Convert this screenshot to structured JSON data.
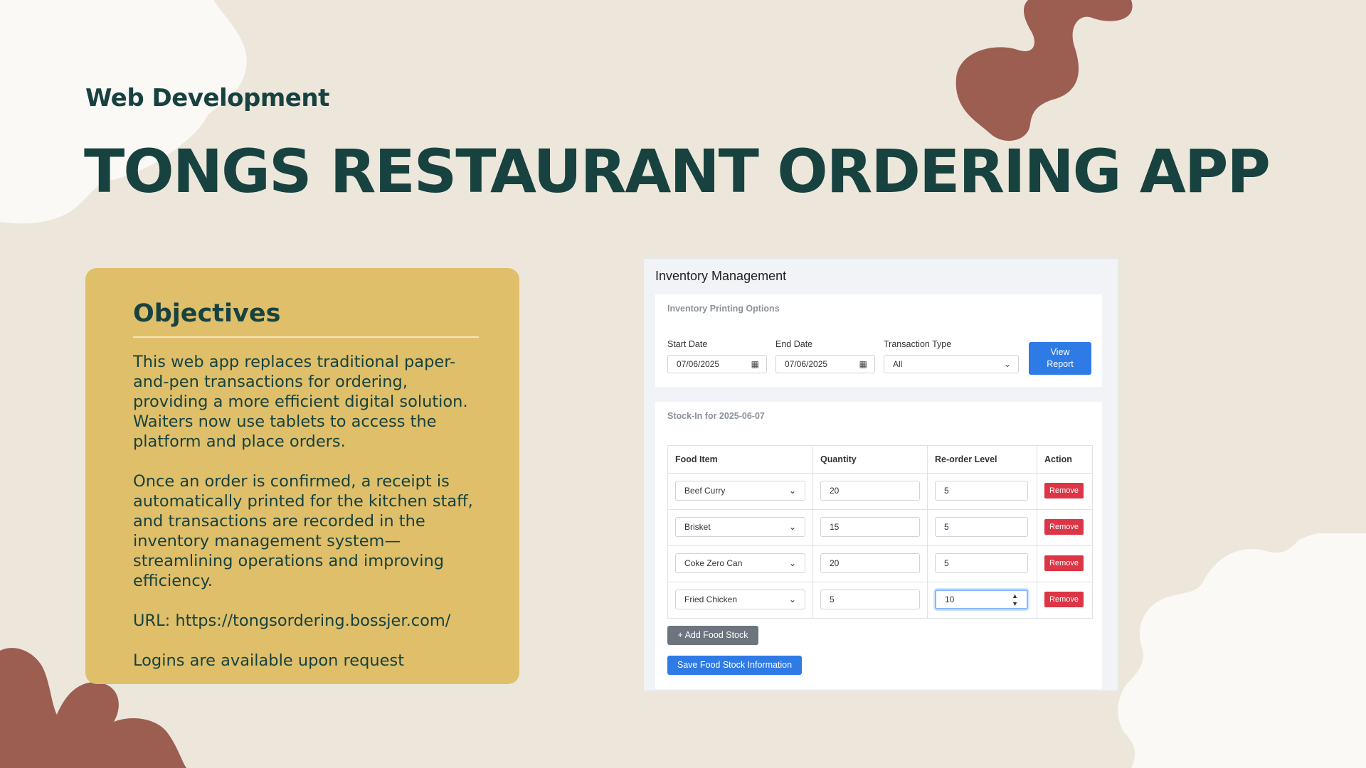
{
  "slide": {
    "subtitle": "Web Development",
    "title": "TONGS RESTAURANT ORDERING APP",
    "colors": {
      "background": "#EDE7DB",
      "heading": "#17423F",
      "card": "#DFBF6A",
      "accent_brown": "#9B5E51",
      "cream": "#FAF9F5"
    }
  },
  "objectives": {
    "heading": "Objectives",
    "paragraph1": "This web app replaces traditional paper-and-pen transactions for ordering, providing a more efficient digital solution. Waiters now use tablets to access the platform and place orders.",
    "paragraph2": "Once an order is confirmed, a receipt is automatically printed for the kitchen staff, and transactions are recorded in the inventory management system—streamlining operations and improving efficiency.",
    "url": "URL: https://tongsordering.bossjer.com/",
    "logins": "Logins are available upon request"
  },
  "app": {
    "title": "Inventory Management",
    "printing": {
      "label": "Inventory Printing Options",
      "start_date_label": "Start Date",
      "start_date": "07/06/2025",
      "end_date_label": "End Date",
      "end_date": "07/06/2025",
      "transaction_type_label": "Transaction Type",
      "transaction_type": "All",
      "view_report_line1": "View",
      "view_report_line2": "Report",
      "calendar_icon": "calendar-icon",
      "chevron_icon": "chevron-down-icon"
    },
    "stock_in": {
      "label": "Stock-In for 2025-06-07",
      "columns": [
        "Food Item",
        "Quantity",
        "Re-order Level",
        "Action"
      ],
      "rows": [
        {
          "food_item": "Beef Curry",
          "quantity": "20",
          "reorder_level": "5",
          "action": "Remove"
        },
        {
          "food_item": "Brisket",
          "quantity": "15",
          "reorder_level": "5",
          "action": "Remove"
        },
        {
          "food_item": "Coke Zero Can",
          "quantity": "20",
          "reorder_level": "5",
          "action": "Remove"
        },
        {
          "food_item": "Fried Chicken",
          "quantity": "5",
          "reorder_level": "10",
          "action": "Remove"
        }
      ],
      "add_button": "+ Add Food Stock",
      "save_button": "Save Food Stock Information"
    }
  }
}
